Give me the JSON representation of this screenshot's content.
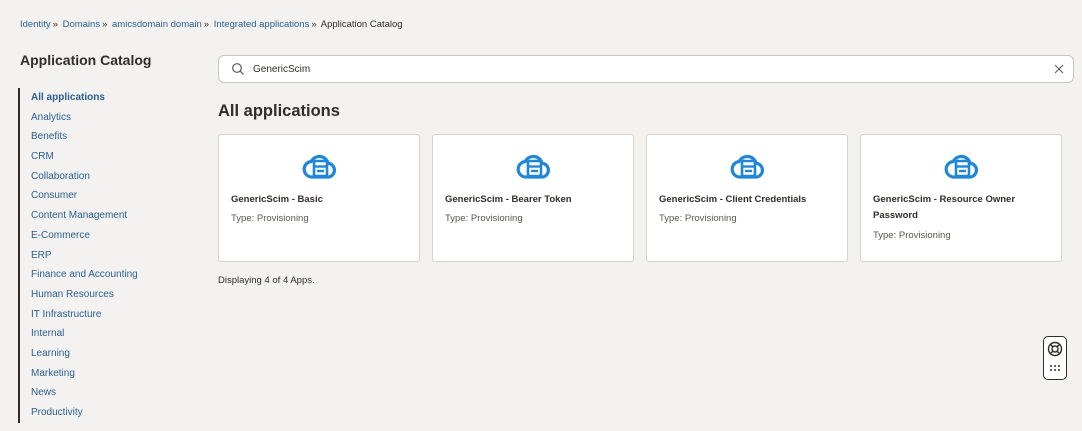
{
  "breadcrumb": [
    {
      "label": "Identity"
    },
    {
      "label": "Domains"
    },
    {
      "label": "amicsdomain domain"
    },
    {
      "label": "Integrated applications"
    },
    {
      "label": "Application Catalog"
    }
  ],
  "breadcrumb_separator": "»",
  "sidebar": {
    "title": "Application Catalog",
    "items": [
      {
        "label": "All applications",
        "active": true
      },
      {
        "label": "Analytics"
      },
      {
        "label": "Benefits"
      },
      {
        "label": "CRM"
      },
      {
        "label": "Collaboration"
      },
      {
        "label": "Consumer"
      },
      {
        "label": "Content Management"
      },
      {
        "label": "E-Commerce"
      },
      {
        "label": "ERP"
      },
      {
        "label": "Finance and Accounting"
      },
      {
        "label": "Human Resources"
      },
      {
        "label": "IT Infrastructure"
      },
      {
        "label": "Internal"
      },
      {
        "label": "Learning"
      },
      {
        "label": "Marketing"
      },
      {
        "label": "News"
      },
      {
        "label": "Productivity"
      }
    ]
  },
  "search": {
    "value": "GenericScim",
    "icon": "search-icon",
    "clear_icon": "close-icon"
  },
  "main": {
    "title": "All applications",
    "cards": [
      {
        "name": "GenericScim - Basic",
        "type": "Type: Provisioning"
      },
      {
        "name": "GenericScim - Bearer Token",
        "type": "Type: Provisioning"
      },
      {
        "name": "GenericScim - Client Credentials",
        "type": "Type: Provisioning"
      },
      {
        "name": "GenericScim - Resource Owner Password",
        "type": "Type: Provisioning"
      }
    ],
    "card_icon": "cloud-app-icon",
    "count_text": "Displaying 4 of 4 Apps."
  },
  "colors": {
    "link": "#2b5f8f",
    "icon_blue": "#1f86d8",
    "text": "#312d2a",
    "background": "#f3f2f0"
  },
  "help_widget": {
    "icons": [
      "lifebuoy-icon",
      "grid-icon"
    ]
  }
}
